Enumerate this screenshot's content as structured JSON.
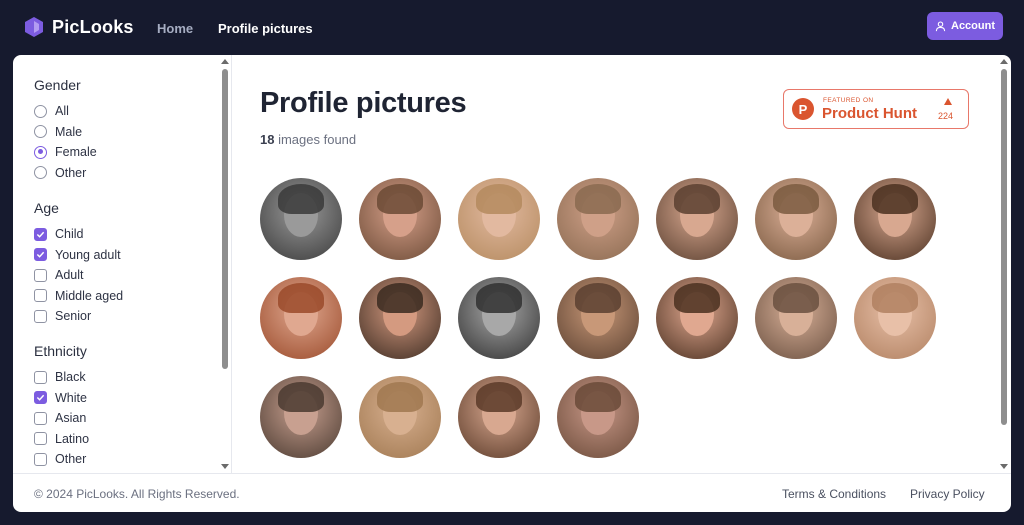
{
  "app": {
    "name": "PicLooks"
  },
  "nav": {
    "home": "Home",
    "profile_pictures": "Profile pictures",
    "account": "Account"
  },
  "filters": {
    "gender": {
      "title": "Gender",
      "options": [
        {
          "label": "All",
          "selected": false
        },
        {
          "label": "Male",
          "selected": false
        },
        {
          "label": "Female",
          "selected": true
        },
        {
          "label": "Other",
          "selected": false
        }
      ]
    },
    "age": {
      "title": "Age",
      "options": [
        {
          "label": "Child",
          "checked": true
        },
        {
          "label": "Young adult",
          "checked": true
        },
        {
          "label": "Adult",
          "checked": false
        },
        {
          "label": "Middle aged",
          "checked": false
        },
        {
          "label": "Senior",
          "checked": false
        }
      ]
    },
    "ethnicity": {
      "title": "Ethnicity",
      "options": [
        {
          "label": "Black",
          "checked": false
        },
        {
          "label": "White",
          "checked": true
        },
        {
          "label": "Asian",
          "checked": false
        },
        {
          "label": "Latino",
          "checked": false
        },
        {
          "label": "Other",
          "checked": false
        }
      ]
    }
  },
  "main": {
    "title": "Profile pictures",
    "count_number": "18",
    "count_text": " images found"
  },
  "product_hunt": {
    "featured": "FEATURED ON",
    "name": "Product Hunt",
    "votes": "224"
  },
  "images": [
    {
      "skin": "#9a9a9a",
      "hair": "#3a3a3a"
    },
    {
      "skin": "#d6a08a",
      "hair": "#6b4a35"
    },
    {
      "skin": "#e2b9a0",
      "hair": "#b48a5e"
    },
    {
      "skin": "#cfa088",
      "hair": "#8a6a50"
    },
    {
      "skin": "#d8a890",
      "hair": "#5a4030"
    },
    {
      "skin": "#dcb098",
      "hair": "#7a5a40"
    },
    {
      "skin": "#d8a890",
      "hair": "#4a3020"
    },
    {
      "skin": "#e0a890",
      "hair": "#9a4a2a"
    },
    {
      "skin": "#d49a80",
      "hair": "#3a2a20"
    },
    {
      "skin": "#a8a8a8",
      "hair": "#303030"
    },
    {
      "skin": "#c89878",
      "hair": "#5a4030"
    },
    {
      "skin": "#e0a890",
      "hair": "#4a3020"
    },
    {
      "skin": "#d8b098",
      "hair": "#6a5040"
    },
    {
      "skin": "#e8c0a8",
      "hair": "#b08060"
    },
    {
      "skin": "#c8a090",
      "hair": "#4a3a30"
    },
    {
      "skin": "#d8b090",
      "hair": "#a07850"
    },
    {
      "skin": "#d8a890",
      "hair": "#5a3a28"
    },
    {
      "skin": "#c89888",
      "hair": "#6a4a38"
    }
  ],
  "footer": {
    "copyright": "© 2024 PicLooks. All Rights Reserved.",
    "terms": "Terms & Conditions",
    "privacy": "Privacy Policy"
  },
  "colors": {
    "accent": "#7c5ce0",
    "nav_bg": "#161a2e",
    "product_hunt": "#da552f"
  }
}
